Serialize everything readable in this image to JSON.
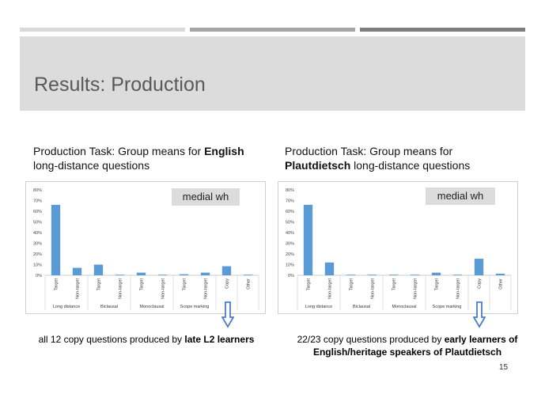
{
  "slide": {
    "title": "Results: Production",
    "page_number": "15"
  },
  "colors": {
    "bar": "#5b9bd5",
    "arrow": "#4a7ec8",
    "title_band": "#dcdcdc"
  },
  "panels": [
    {
      "title_parts": [
        "Production Task: Group means for ",
        "English",
        " long-distance questions"
      ],
      "badge": "medial wh",
      "caption_parts": [
        "all 12 copy questions produced by ",
        "late L2 learners"
      ],
      "arrow_icon": "down-arrow-icon"
    },
    {
      "title_parts": [
        "Production Task: Group means for ",
        "Plautdietsch",
        " long-distance questions"
      ],
      "badge": "medial wh",
      "caption_parts": [
        "22/23 copy questions produced by ",
        "early learners of English/heritage speakers of Plautdietsch"
      ],
      "arrow_icon": "down-arrow-icon"
    }
  ],
  "chart_data": [
    {
      "type": "bar",
      "categories": [
        "Target",
        "Non-target",
        "Target",
        "Non-target",
        "Target",
        "Non-target",
        "Target",
        "Non-target",
        "Copy",
        "Other"
      ],
      "groups": [
        {
          "label": "Long distance",
          "span": 2
        },
        {
          "label": "Biclausal",
          "span": 2
        },
        {
          "label": "Monoclausal",
          "span": 2
        },
        {
          "label": "Scope marking",
          "span": 2
        },
        {
          "label": "",
          "span": 1
        },
        {
          "label": "",
          "span": 1
        }
      ],
      "values": [
        66,
        7,
        10,
        0.5,
        2.5,
        0.2,
        1,
        2.5,
        8.5,
        0.5
      ],
      "ylim": [
        0,
        80
      ],
      "yticks": [
        "0%",
        "10%",
        "20%",
        "30%",
        "40%",
        "50%",
        "60%",
        "70%",
        "80%"
      ],
      "grid": false
    },
    {
      "type": "bar",
      "categories": [
        "Target",
        "Non-target",
        "Target",
        "Non-target",
        "Target",
        "Non-target",
        "Target",
        "Non-target",
        "Copy",
        "Other"
      ],
      "groups": [
        {
          "label": "Long distance",
          "span": 2
        },
        {
          "label": "Biclausal",
          "span": 2
        },
        {
          "label": "Monoclausal",
          "span": 2
        },
        {
          "label": "Scope marking",
          "span": 2
        },
        {
          "label": "",
          "span": 1
        },
        {
          "label": "",
          "span": 1
        }
      ],
      "values": [
        66,
        12,
        0.5,
        0.2,
        0.5,
        0.2,
        2.5,
        0.5,
        15.5,
        1.5
      ],
      "ylim": [
        0,
        80
      ],
      "yticks": [
        "0%",
        "10%",
        "20%",
        "30%",
        "40%",
        "50%",
        "60%",
        "70%",
        "80%"
      ],
      "grid": false
    }
  ]
}
